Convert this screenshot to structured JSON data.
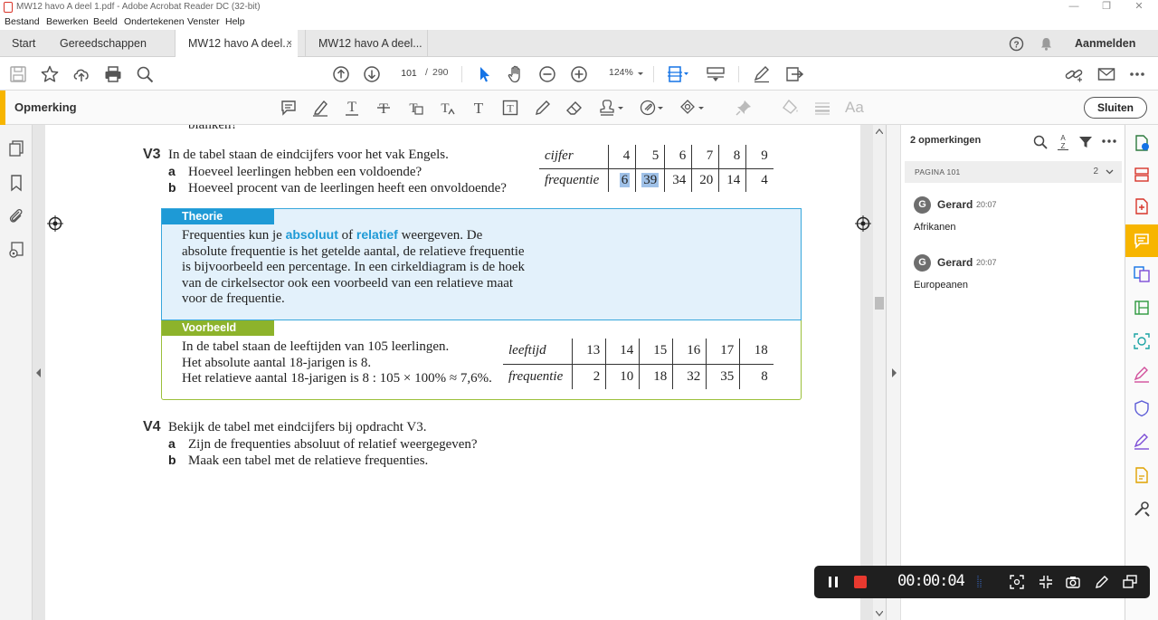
{
  "window": {
    "title": "MW12 havo A deel 1.pdf - Adobe Acrobat Reader DC (32-bit)",
    "minimize": "—",
    "restore": "❐",
    "close": "✕"
  },
  "menu": [
    "Bestand",
    "Bewerken",
    "Beeld",
    "Ondertekenen",
    "Venster",
    "Help"
  ],
  "tabs": {
    "start": "Start",
    "tools": "Gereedschappen",
    "docs": [
      {
        "label": "MW12 havo A deel...",
        "active": true,
        "close": "×"
      },
      {
        "label": "MW12 havo A deel...",
        "active": false
      }
    ],
    "signin": "Aanmelden"
  },
  "toolbar": {
    "page_current": "101",
    "page_sep": "/",
    "page_total": "290",
    "zoom": "124%"
  },
  "comment_toolbar": {
    "label": "Opmerking",
    "close_button": "Sluiten",
    "aa_label": "Aa"
  },
  "document": {
    "cut_top_text": "blanken?",
    "v3": {
      "number": "V3",
      "question": "In de tabel staan de eindcijfers voor het vak Engels.",
      "a_letter": "a",
      "a": "Hoeveel leerlingen hebben een voldoende?",
      "b_letter": "b",
      "b": "Hoeveel procent van de leerlingen heeft een onvoldoende?",
      "table": {
        "row1_head": "cijfer",
        "row2_head": "frequentie",
        "cijfers": [
          "4",
          "5",
          "6",
          "7",
          "8",
          "9"
        ],
        "frequenties": [
          "6",
          "39",
          "34",
          "20",
          "14",
          "4"
        ]
      }
    },
    "theorie": {
      "header": "Theorie",
      "line1_pre": "Frequenties kun je ",
      "kw1": "absoluut",
      "line1_mid": " of ",
      "kw2": "relatief",
      "line1_post": " weergeven. De",
      "line2": "absolute frequentie is het getelde aantal, de relatieve frequentie",
      "line3": "is bijvoorbeeld een percentage. In een cirkeldiagram is de hoek",
      "line4": "van de cirkelsector ook een voorbeeld van een relatieve maat",
      "line5": "voor de frequentie."
    },
    "voorbeeld": {
      "header": "Voorbeeld",
      "line1": "In de tabel staan de leeftijden van 105 leerlingen.",
      "line2": "Het absolute aantal 18-jarigen is 8.",
      "line3": "Het relatieve aantal 18-jarigen is 8 : 105 × 100% ≈ 7,6%.",
      "table": {
        "row1_head": "leeftijd",
        "row2_head": "frequentie",
        "ages": [
          "13",
          "14",
          "15",
          "16",
          "17",
          "18"
        ],
        "freqs": [
          "2",
          "10",
          "18",
          "32",
          "35",
          "8"
        ]
      }
    },
    "v4": {
      "number": "V4",
      "question": "Bekijk de tabel met eindcijfers bij opdracht V3.",
      "a_letter": "a",
      "a": "Zijn de frequenties absoluut of relatief weergegeven?",
      "b_letter": "b",
      "b": "Maak een tabel met de relatieve frequenties."
    }
  },
  "comments_panel": {
    "title": "2 opmerkingen",
    "page_label": "PAGINA 101",
    "page_count": "2",
    "comments": [
      {
        "initials": "G",
        "author": "Gerard",
        "time": "20:07",
        "text": "Afrikanen"
      },
      {
        "initials": "G",
        "author": "Gerard",
        "time": "20:07",
        "text": "Europeanen"
      }
    ]
  },
  "recorder": {
    "timer": "00:00:04"
  },
  "colors": {
    "accent_yellow": "#f7b500",
    "theorie_blue": "#1e9ad6",
    "voorbeeld_green": "#8db32b",
    "highlight": "#9fc1e8"
  }
}
